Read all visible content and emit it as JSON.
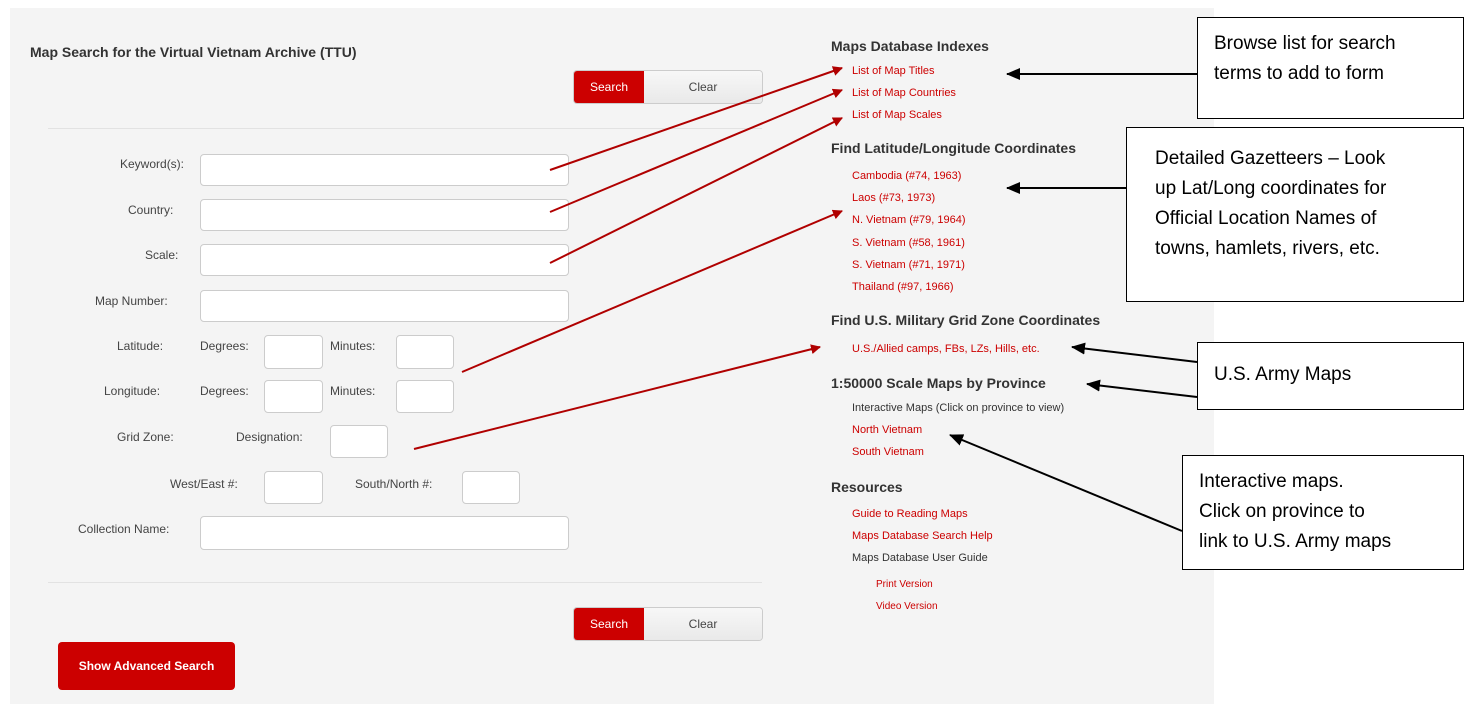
{
  "form": {
    "title": "Map Search for the Virtual Vietnam Archive (TTU)",
    "search_label": "Search",
    "clear_label": "Clear",
    "keywords_label": "Keyword(s):",
    "country_label": "Country:",
    "scale_label": "Scale:",
    "map_number_label": "Map Number:",
    "latitude_label": "Latitude:",
    "longitude_label": "Longitude:",
    "degrees_label": "Degrees:",
    "minutes_label": "Minutes:",
    "grid_zone_label": "Grid Zone:",
    "designation_label": "Designation:",
    "west_east_label": "West/East #:",
    "south_north_label": "South/North #:",
    "collection_label": "Collection Name:",
    "advanced_label": "Show Advanced Search"
  },
  "sidebar": {
    "indexes_heading": "Maps Database Indexes",
    "indexes": [
      "List of Map Titles",
      "List of Map Countries",
      "List of Map Scales"
    ],
    "latlong_heading": "Find Latitude/Longitude Coordinates",
    "gazetteers": [
      "Cambodia (#74, 1963)",
      "Laos (#73, 1973)",
      "N. Vietnam (#79, 1964)",
      "S. Vietnam (#58, 1961)",
      "S. Vietnam (#71, 1971)",
      "Thailand (#97, 1966)"
    ],
    "grid_heading": "Find U.S. Military Grid Zone Coordinates",
    "grid_link": "U.S./Allied camps, FBs, LZs, Hills, etc.",
    "province_heading": "1:50000 Scale Maps by Province",
    "interactive_text": "Interactive Maps (Click on province to view)",
    "north_vietnam": "North Vietnam",
    "south_vietnam": "South Vietnam",
    "resources_heading": "Resources",
    "guide_reading": "Guide to Reading Maps",
    "search_help": "Maps Database Search Help",
    "user_guide": "Maps Database User Guide",
    "print_version": "Print Version",
    "video_version": "Video Version"
  },
  "annotations": {
    "browse": [
      "Browse list for search",
      "terms to add to form"
    ],
    "gazetteers": [
      "Detailed Gazetteers – Look",
      "up Lat/Long coordinates for",
      "Official Location Names of",
      "towns, hamlets, rivers, etc."
    ],
    "army": [
      "U.S. Army Maps"
    ],
    "interactive": [
      "Interactive maps.",
      "Click on province to",
      "link to U.S. Army maps"
    ]
  },
  "colors": {
    "accent": "#cc0000",
    "arrow": "#b00000",
    "panel": "#f4f4f4"
  }
}
